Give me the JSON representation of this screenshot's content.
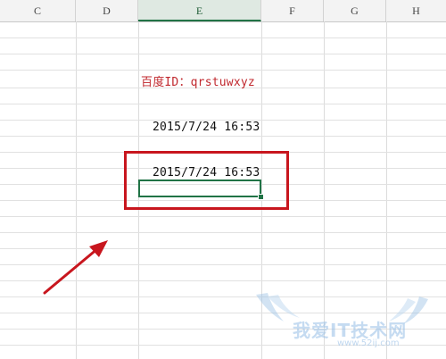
{
  "columns": [
    "C",
    "D",
    "E",
    "F",
    "G",
    "H"
  ],
  "selected_column": "E",
  "cells": {
    "baidu_id": "百度ID：qrstuwxyz",
    "datetime_1": "2015/7/24 16:53",
    "datetime_2": "2015/7/24 16:53",
    "active_cell_value": ""
  },
  "annotations": {
    "highlight_color": "#c8161e",
    "arrow_color": "#c8161e"
  },
  "watermark": {
    "text": "我爱IT技术网",
    "url": "www.52ij.com"
  },
  "colors": {
    "selection": "#217346",
    "header_bg": "#f3f3f3",
    "red_text": "#c0272d"
  }
}
